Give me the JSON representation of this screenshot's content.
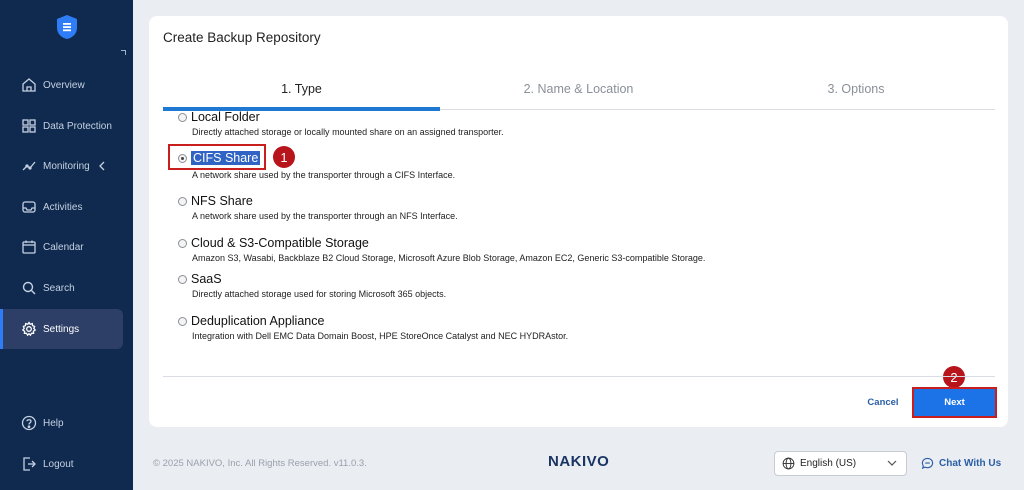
{
  "sidebar": {
    "items": [
      {
        "label": "Overview",
        "icon": "home-icon"
      },
      {
        "label": "Data Protection",
        "icon": "grid-icon"
      },
      {
        "label": "Monitoring",
        "icon": "chart-line-icon"
      },
      {
        "label": "Activities",
        "icon": "inbox-icon"
      },
      {
        "label": "Calendar",
        "icon": "calendar-icon"
      },
      {
        "label": "Search",
        "icon": "search-icon"
      },
      {
        "label": "Settings",
        "icon": "gear-icon"
      }
    ],
    "help": "Help",
    "logout": "Logout"
  },
  "dialog": {
    "title": "Create Backup Repository",
    "tabs": [
      "1. Type",
      "2. Name & Location",
      "3. Options"
    ],
    "active_tab": 0,
    "options": [
      {
        "label": "Local Folder",
        "desc": "Directly attached storage or locally mounted share on an assigned transporter."
      },
      {
        "label": "CIFS Share",
        "desc": "A network share used by the transporter through a CIFS Interface."
      },
      {
        "label": "NFS Share",
        "desc": "A network share used by the transporter through an NFS Interface."
      },
      {
        "label": "Cloud & S3-Compatible Storage",
        "desc": "Amazon S3, Wasabi, Backblaze B2 Cloud Storage, Microsoft Azure Blob Storage, Amazon EC2, Generic S3-compatible Storage."
      },
      {
        "label": "SaaS",
        "desc": "Directly attached storage used for storing Microsoft 365 objects."
      },
      {
        "label": "Deduplication Appliance",
        "desc": "Integration with Dell EMC Data Domain Boost, HPE StoreOnce Catalyst and NEC HYDRAstor."
      }
    ],
    "selected_option": 1,
    "cancel": "Cancel",
    "next": "Next",
    "annotations": [
      "1",
      "2"
    ]
  },
  "footer": {
    "copyright": "© 2025 NAKIVO, Inc. All Rights Reserved. v11.0.3.",
    "brand": "NAKIVO",
    "language": "English (US)",
    "chat": "Chat With Us"
  },
  "colors": {
    "sidebar_bg": "#0f2a4e",
    "accent": "#1c73e8",
    "annotation": "#b8141c"
  }
}
